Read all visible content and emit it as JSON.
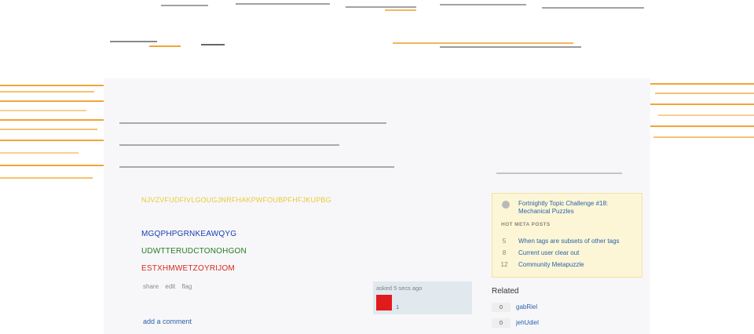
{
  "question": {
    "lines": {
      "garbled": "NJVZVFUDFIVLGOUGJNRFHAKPWFOUBPFHFJKUPBG",
      "blue": "MGQPHPGRNKEAWQYG",
      "green": "UDWTTERUDCTONOHGON",
      "red": "ESTXHMWETZOYRIJOM"
    },
    "menu": {
      "share": "share",
      "edit": "edit",
      "flag": "flag"
    },
    "owner": {
      "asked": "asked 5 secs ago",
      "rep": "1"
    },
    "add_comment": "add a comment"
  },
  "sidebar": {
    "featured_title": "Fortnightly Topic Challenge #18: Mechanical Puzzles",
    "hot_meta_header": "HOT META POSTS",
    "hot_meta": [
      {
        "count": "5",
        "title": "When tags are subsets of other tags"
      },
      {
        "count": "8",
        "title": "Current user clear out"
      },
      {
        "count": "12",
        "title": "Community Metapuzzle"
      }
    ],
    "related_title": "Related",
    "related": [
      {
        "score": "0",
        "title": "gabRiel"
      },
      {
        "score": "0",
        "title": "jehUdiel"
      }
    ]
  },
  "colors": {
    "accent_link": "#2b62a8",
    "meta_box_bg": "#fcf6d6",
    "avatar": "#e01b1b",
    "header_orange": "#f2a43a"
  }
}
